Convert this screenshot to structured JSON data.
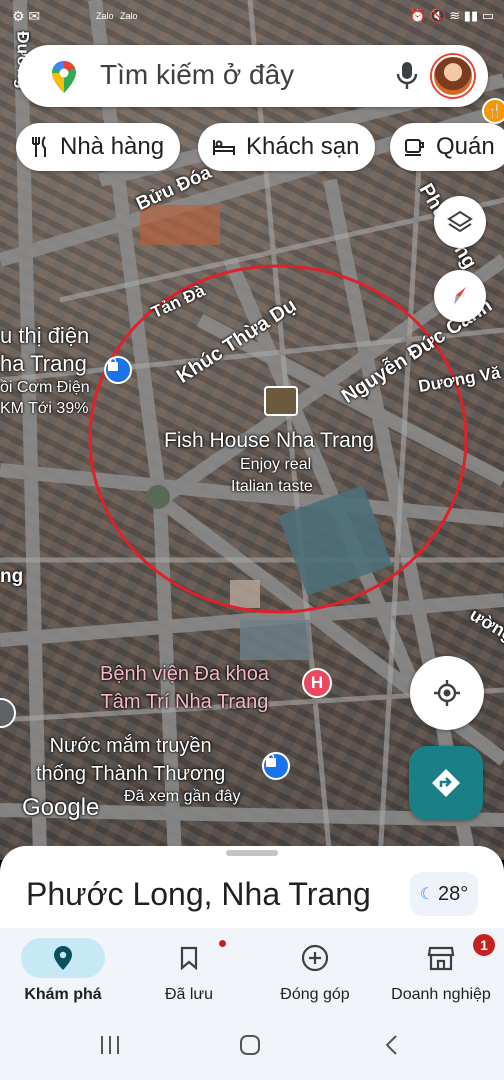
{
  "search": {
    "placeholder": "Tìm kiếm ở đây"
  },
  "chips": [
    {
      "label": "Nhà hàng",
      "icon": "restaurant-icon"
    },
    {
      "label": "Khách sạn",
      "icon": "hotel-icon"
    },
    {
      "label": "Quán",
      "icon": "coffee-icon"
    }
  ],
  "map": {
    "roads": {
      "buu_doa": "Bửu Đóa",
      "tan_da": "Tản Đà",
      "khuc_thua_du": "Khúc Thừa Dụ",
      "nguyen_duc_canh": "Nguyễn Đức Cảnh",
      "duong_va": "Dương Vă",
      "phu_hung": "Phù Đổng",
      "duong": "Đường",
      "ng": "ng",
      "uong": "ường"
    },
    "pois": {
      "sieu_thi_line1": "u thị điện",
      "sieu_thi_line2": "ha Trang",
      "sieu_thi_line3": "ồi Cơm Điện",
      "sieu_thi_line4": "KM Tới 39%",
      "fish_house_name": "Fish House Nha Trang",
      "fish_house_tag1": "Enjoy real",
      "fish_house_tag2": "Italian taste",
      "hospital_line1": "Bệnh viện Đa khoa",
      "hospital_line2": "Tâm Trí Nha Trang",
      "nuoc_mam_line1": "Nước mắm truyền",
      "nuoc_mam_line2": "thống Thành Thương",
      "nuoc_mam_sub": "Đã xem gần đây"
    },
    "google_logo": "Google",
    "circle_color": "#e0202a"
  },
  "status": {
    "carrier": "Zalo",
    "carrier2": "Zalo"
  },
  "sheet": {
    "place": "Phước Long, Nha Trang",
    "temperature": "28°"
  },
  "nav": [
    {
      "label": "Khám phá",
      "icon": "explore-pin-icon",
      "active": true
    },
    {
      "label": "Đã lưu",
      "icon": "bookmark-icon"
    },
    {
      "label": "Đóng góp",
      "icon": "add-circle-icon"
    },
    {
      "label": "Doanh nghiệp",
      "icon": "store-icon",
      "badge": "1"
    }
  ],
  "colors": {
    "accent": "#1a7f86",
    "brand_red": "#ea4335",
    "active_nav": "#c7e9f5"
  }
}
